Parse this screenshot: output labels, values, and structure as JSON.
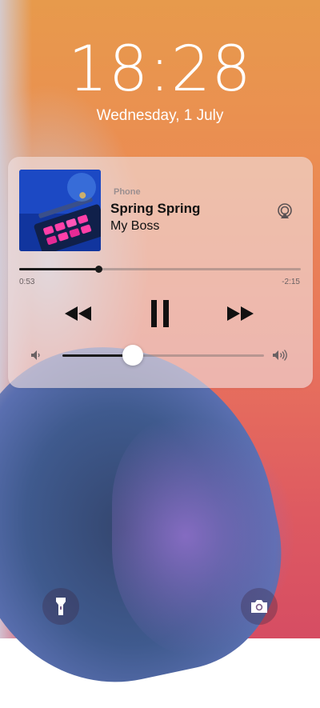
{
  "lockscreen": {
    "time": "18:28",
    "date": "Wednesday, 1 July"
  },
  "now_playing": {
    "source": "Phone",
    "title": "Spring Spring",
    "artist": "My Boss",
    "elapsed": "0:53",
    "remaining": "-2:15",
    "progress": 0.28,
    "volume": 0.35
  },
  "icons": {
    "airplay": "airplay-icon",
    "rewind": "rewind-icon",
    "pause": "pause-icon",
    "forward": "fast-forward-icon",
    "volume_low": "volume-low-icon",
    "volume_high": "volume-high-icon",
    "flashlight": "flashlight-icon",
    "camera": "camera-icon"
  },
  "colors": {
    "accent": "#1a1a1a",
    "card": "#f0e1e1"
  }
}
